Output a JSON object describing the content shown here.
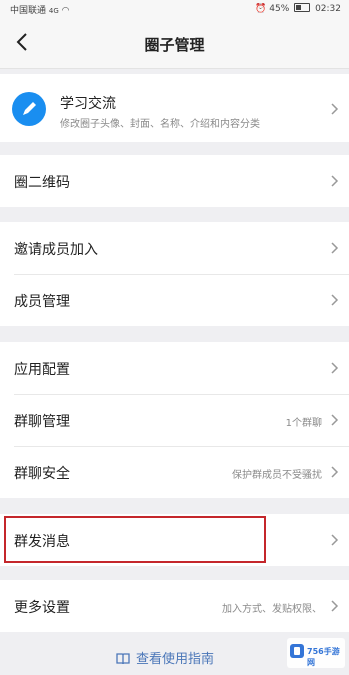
{
  "status_bar": {
    "carrier": "中国联通",
    "signal": "4G",
    "battery": "45%",
    "time": "02:32"
  },
  "nav": {
    "title": "圈子管理"
  },
  "circle": {
    "name": "学习交流",
    "description": "修改圈子头像、封面、名称、介绍和内容分类"
  },
  "groups": {
    "qr": {
      "label": "圈二维码"
    },
    "invite": {
      "label": "邀请成员加入"
    },
    "members": {
      "label": "成员管理"
    },
    "app_config": {
      "label": "应用配置"
    },
    "group_chat": {
      "label": "群聊管理",
      "value": "1个群聊"
    },
    "group_security": {
      "label": "群聊安全",
      "value": "保护群成员不受骚扰"
    },
    "broadcast": {
      "label": "群发消息"
    },
    "more": {
      "label": "更多设置",
      "value": "加入方式、发贴权限、"
    }
  },
  "guide": {
    "label": "查看使用指南"
  },
  "watermark": {
    "text": "756手游网"
  },
  "colors": {
    "accent": "#1a8ef0",
    "highlight": "#c4262b",
    "link": "#4a76b8",
    "background": "#efeff2"
  }
}
